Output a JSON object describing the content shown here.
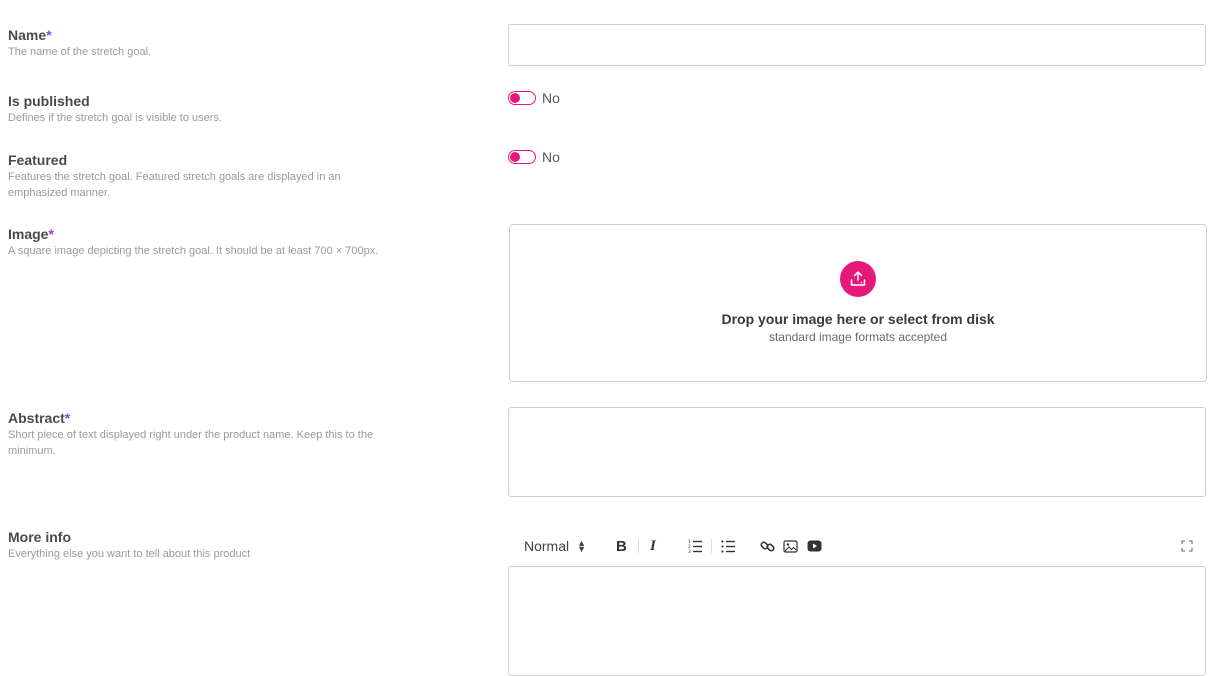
{
  "fields": {
    "name": {
      "label": "Name",
      "required_mark": "*",
      "help": "The name of the stretch goal.",
      "value": ""
    },
    "published": {
      "label": "Is published",
      "help": "Defines if the stretch goal is visible to users.",
      "toggle_text": "No"
    },
    "featured": {
      "label": "Featured",
      "help_line1": "Features the stretch goal. Featured stretch goals are displayed in an",
      "help_line2": "emphasized manner.",
      "toggle_text": "No"
    },
    "image": {
      "label": "Image",
      "required_mark": "*",
      "help": "A square image depicting the stretch goal. It should be at least 700 × 700px.",
      "drop_title": "Drop your image here or select from disk",
      "drop_subtitle": "standard image formats accepted"
    },
    "abstract": {
      "label": "Abstract",
      "required_mark": "*",
      "help_line1": "Short piece of text displayed right under the product name. Keep this to the",
      "help_line2": "minimum.",
      "value": ""
    },
    "more_info": {
      "label": "More info",
      "help": "Everything else you want to tell about this product",
      "editor": {
        "block_style": "Normal",
        "bold": "B",
        "italic": "I"
      }
    }
  },
  "colors": {
    "accent": "#e6197a",
    "required": "#8e44d6",
    "border": "#cfcfcf"
  },
  "icons": [
    "upload-icon",
    "ordered-list-icon",
    "bullet-list-icon",
    "link-icon",
    "image-icon",
    "video-icon",
    "fullscreen-icon"
  ]
}
